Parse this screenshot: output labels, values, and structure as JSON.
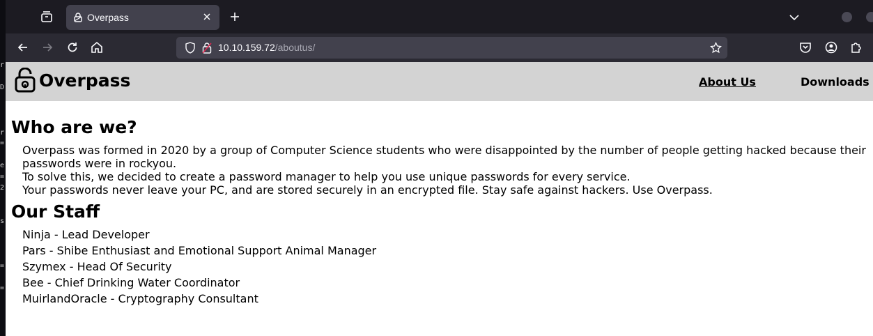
{
  "browser": {
    "tab_title": "Overpass",
    "url_host": "10.10.159.72",
    "url_path": "/aboutus/"
  },
  "site": {
    "logo_text": "Overpass",
    "nav": [
      "About Us",
      "Downloads"
    ]
  },
  "about": {
    "heading": "Who are we?",
    "lines": [
      "Overpass was formed in 2020 by a group of Computer Science students who were disappointed by the number of people getting hacked because their",
      "passwords were in rockyou.",
      "To solve this, we decided to create a password manager to help you use unique passwords for every service.",
      "Your passwords never leave your PC, and are stored securely in an encrypted file. Stay safe against hackers. Use Overpass."
    ]
  },
  "staff": {
    "heading": "Our Staff",
    "members": [
      "Ninja - Lead Developer",
      "Pars - Shibe Enthusiast and Emotional Support Animal Manager",
      "Szymex - Head Of Security",
      "Bee - Chief Drinking Water Coordinator",
      "MuirlandOracle - Cryptography Consultant"
    ]
  },
  "icons": [
    "tab-list-icon",
    "lock-icon",
    "close-icon",
    "plus-icon",
    "chevron-down-icon",
    "back-icon",
    "forward-icon",
    "reload-icon",
    "home-icon",
    "shield-icon",
    "insecure-lock-icon",
    "star-icon",
    "pocket-icon",
    "account-icon",
    "extensions-icon",
    "padlock-logo-icon"
  ],
  "colors": {
    "tab_active": "#42414d",
    "toolbar": "#2b2a33",
    "header_bg": "#d3d3d3"
  }
}
